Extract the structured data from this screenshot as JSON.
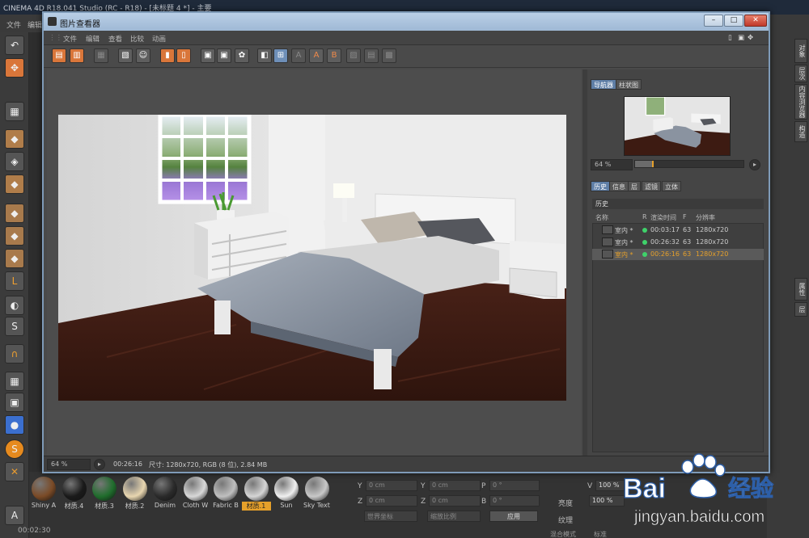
{
  "app": {
    "title": "CINEMA 4D R18.041 Studio (RC - R18) - [未标题 4 *] - 主要",
    "menu": [
      "文件",
      "编辑"
    ],
    "status_time": "00:02:30"
  },
  "right_tabs": [
    "对象",
    "层次",
    "内容浏览器",
    "构造",
    "属性",
    "层"
  ],
  "materials": [
    {
      "name": "Shiny A",
      "color": "#7a4a26"
    },
    {
      "name": "材质.4",
      "color": "#1a1a1a"
    },
    {
      "name": "材质.3",
      "color": "#1f6d2c"
    },
    {
      "name": "材质.2",
      "color": "#e8d6b0"
    },
    {
      "name": "Denim",
      "color": "#2a2a2a"
    },
    {
      "name": "Cloth W",
      "color": "#d8d8d8"
    },
    {
      "name": "Fabric B",
      "color": "#bfbfbf"
    },
    {
      "name": "材质.1",
      "color": "#d5d5d5"
    },
    {
      "name": "Sun",
      "color": "#f0f0f0"
    },
    {
      "name": "Sky Text",
      "color": "#c8c8c8"
    }
  ],
  "coords": {
    "y_pos": "0 cm",
    "y_size": "0 cm",
    "p_rot": "0 °",
    "z_pos": "0 cm",
    "z_size": "0 cm",
    "b_rot": "0 °",
    "dropdown1": "世界坐标",
    "dropdown2": "缩放比例",
    "apply": "应用",
    "labels": {
      "y": "Y",
      "z": "Z",
      "p": "P",
      "b": "B"
    }
  },
  "attributes": {
    "v_label": "V",
    "v_value": "100 %",
    "brightness": "亮度",
    "brightness_value": "100 %",
    "texture": "纹理",
    "blend_mode": "混合模式",
    "blend_value": "标准"
  },
  "viewer": {
    "title": "图片查看器",
    "menu": [
      "文件",
      "编辑",
      "查看",
      "比较",
      "动画"
    ],
    "zoom": "64 %",
    "render_time": "00:26:16",
    "info": "尺寸: 1280x720, RGB (8 位), 2.84 MB",
    "nav_tabs": [
      "导航器",
      "柱状图"
    ],
    "nav_zoom": "64 %",
    "nav_zoom_fraction": 0.64,
    "info_tabs": [
      "历史",
      "信息",
      "层",
      "滤镜",
      "立体"
    ],
    "history_title": "历史",
    "history_columns": [
      "名称",
      "R",
      "渲染时间",
      "F",
      "分辨率"
    ],
    "history": [
      {
        "name": "室内 *",
        "status_color": "#3fd26a",
        "time": "00:03:17",
        "f": "63",
        "res": "1280x720",
        "selected": false
      },
      {
        "name": "室内 *",
        "status_color": "#3fd26a",
        "time": "00:26:32",
        "f": "63",
        "res": "1280x720",
        "selected": false
      },
      {
        "name": "室内 *",
        "status_color": "#3fd26a",
        "time": "00:26:16",
        "f": "63",
        "res": "1280x720",
        "selected": true
      }
    ]
  },
  "watermark": {
    "brand": "Bai",
    "brand2": "经验",
    "url": "jingyan.baidu.com"
  },
  "colors": {
    "accent": "#e6a02a",
    "title_bar": "#9fb9d5",
    "active_tab": "#5e7ea6"
  }
}
